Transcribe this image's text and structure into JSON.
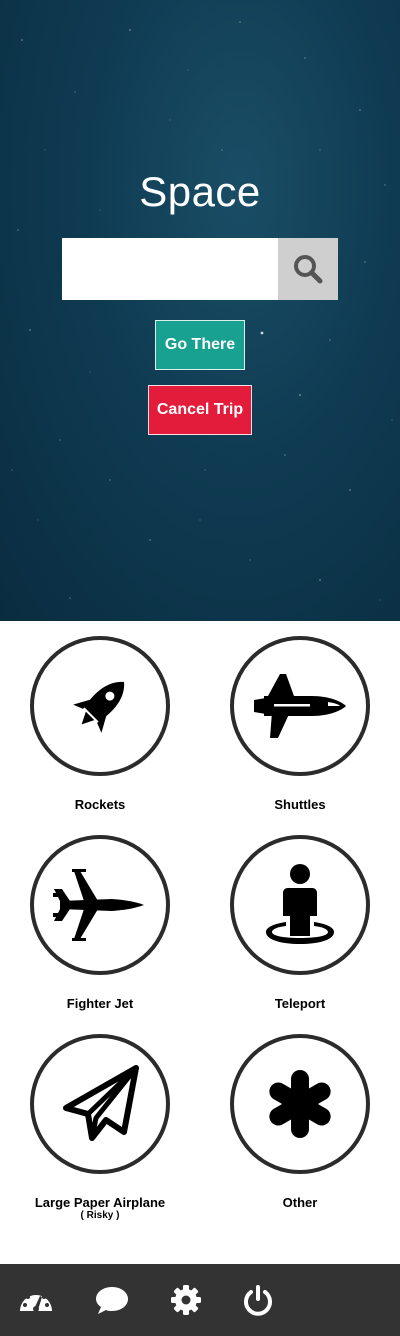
{
  "hero": {
    "title": "Space",
    "search": {
      "value": "",
      "placeholder": "",
      "icon": "search-icon"
    },
    "go_label": "Go There",
    "cancel_label": "Cancel Trip"
  },
  "colors": {
    "go": "#18a090",
    "cancel": "#e41c3c",
    "bottom_bar": "#333333",
    "hero_bg": "#0f3b52"
  },
  "options": [
    {
      "label": "Rockets",
      "icon": "rocket-icon"
    },
    {
      "label": "Shuttles",
      "icon": "space-shuttle-icon"
    },
    {
      "label": "Fighter Jet",
      "icon": "fighter-jet-icon"
    },
    {
      "label": "Teleport",
      "icon": "teleport-icon"
    },
    {
      "label": "Large Paper Airplane",
      "sublabel": "( Risky )",
      "icon": "paper-plane-icon"
    },
    {
      "label": "Other",
      "icon": "asterisk-icon"
    }
  ],
  "bottom_nav": [
    {
      "icon": "dashboard-icon"
    },
    {
      "icon": "chat-icon"
    },
    {
      "icon": "gear-icon"
    },
    {
      "icon": "power-icon"
    }
  ]
}
